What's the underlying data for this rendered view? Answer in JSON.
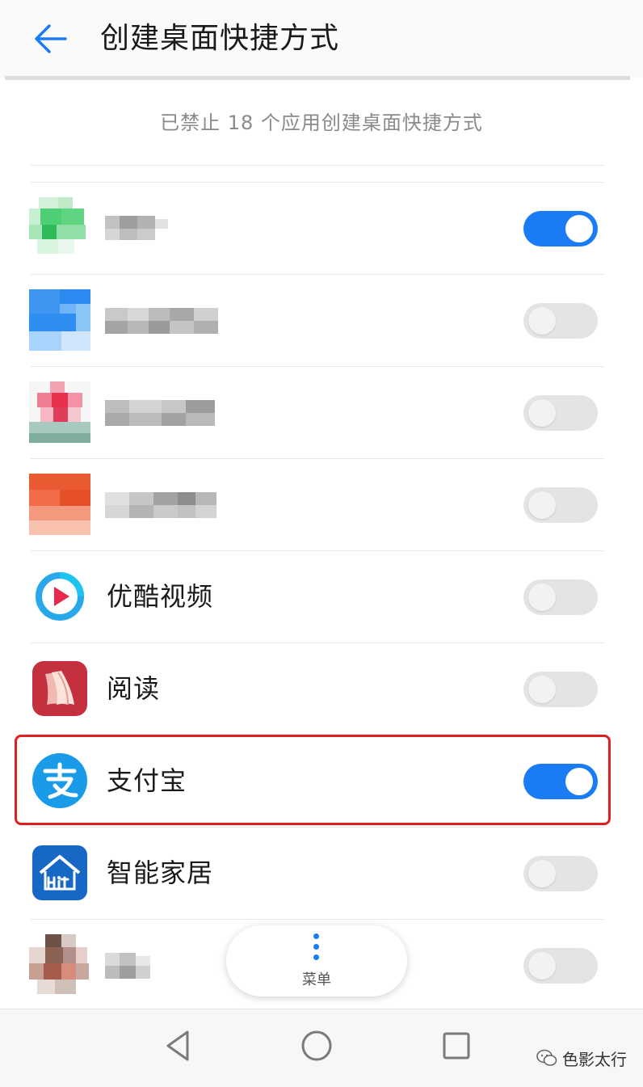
{
  "header": {
    "title": "创建桌面快捷方式",
    "back_icon": "arrow-left-icon",
    "accent_color": "#1a7cf5"
  },
  "subtitle": "已禁止 18 个应用创建桌面快捷方式",
  "apps": [
    {
      "name": "",
      "enabled": true,
      "obscured": true
    },
    {
      "name": "",
      "enabled": false,
      "obscured": true
    },
    {
      "name": "",
      "enabled": false,
      "obscured": true
    },
    {
      "name": "",
      "enabled": false,
      "obscured": true
    },
    {
      "name": "优酷视频",
      "enabled": false,
      "icon": "youku-icon"
    },
    {
      "name": "阅读",
      "enabled": false,
      "icon": "reading-icon"
    },
    {
      "name": "支付宝",
      "enabled": true,
      "icon": "alipay-icon",
      "highlighted": true
    },
    {
      "name": "智能家居",
      "enabled": false,
      "icon": "smart-home-icon"
    },
    {
      "name": "",
      "enabled": false,
      "obscured": true
    }
  ],
  "menu": {
    "label": "菜单",
    "icon": "more-vertical-icon"
  },
  "navbar": {
    "back_icon": "nav-back-icon",
    "home_icon": "nav-home-icon",
    "recents_icon": "nav-recents-icon"
  },
  "watermark": {
    "text": "色影太行",
    "icon": "wechat-icon"
  },
  "colors": {
    "toggle_on": "#1a7cf5",
    "toggle_off": "#e4e4e4",
    "highlight": "#e02020"
  }
}
